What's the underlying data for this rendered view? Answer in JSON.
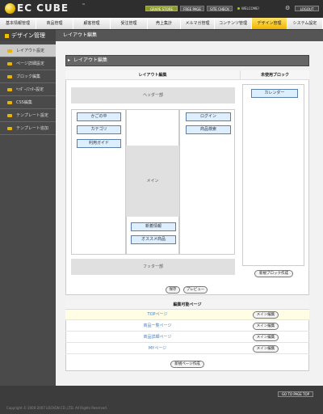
{
  "header": {
    "logo": "EC CUBE",
    "logo_tm": "™",
    "grape_store": "GRAPE STORE",
    "free_page": "FREE PAGE",
    "site_check": "SITE CHECK",
    "welcome": "WELCOME!",
    "logout": "LOGOUT"
  },
  "menu": {
    "items": [
      "基本情報管理",
      "商品管理",
      "顧客管理",
      "受注管理",
      "売上集計",
      "メルマガ管理",
      "コンテンツ管理",
      "デザイン管理",
      "システム設定"
    ],
    "active_index": 7
  },
  "section": {
    "title": "デザイン管理",
    "subtitle": "レイアウト編集"
  },
  "sidebar": {
    "items": [
      "レイアウト設定",
      "ページ詳細設定",
      "ブロック編集",
      "ﾍｯﾀﾞｰ/ﾌｯﾀｰ設定",
      "CSS編集",
      "テンプレート設定",
      "テンプレート追加"
    ],
    "active_index": 0
  },
  "panel": {
    "arrow": "▸",
    "title": "レイアウト編集"
  },
  "layout": {
    "col_layout": "レイアウト編集",
    "col_unused": "未使用ブロック",
    "header_zone": "ヘッダー部",
    "footer_zone": "フッター部",
    "main_zone": "メイン",
    "left_blocks": [
      "かごの中",
      "カテゴリ",
      "利用ガイド"
    ],
    "right_blocks": [
      "ログイン",
      "商品検索"
    ],
    "center_bottom_blocks": [
      "新着情報",
      "オススメ商品"
    ],
    "unused_blocks": [
      "カレンダー"
    ],
    "new_block_button": "新規ブロック作成",
    "save_button": "保存",
    "preview_button": "プレビュー"
  },
  "pages": {
    "header": "編集可能ページ",
    "rows": [
      {
        "name": "TOPページ",
        "edit": "メイン編集",
        "highlight": true
      },
      {
        "name": "商品一覧ページ",
        "edit": "メイン編集",
        "highlight": false
      },
      {
        "name": "商品詳細ページ",
        "edit": "メイン編集",
        "highlight": false
      },
      {
        "name": "MYページ",
        "edit": "メイン編集",
        "highlight": false
      }
    ],
    "new_page_button": "新規ページ作成"
  },
  "footer": {
    "page_top": "GO TO PAGE TOP",
    "copyright": "Copyright © 2000-2007 LOCKON CO.,LTD. All Rights Reserved."
  }
}
